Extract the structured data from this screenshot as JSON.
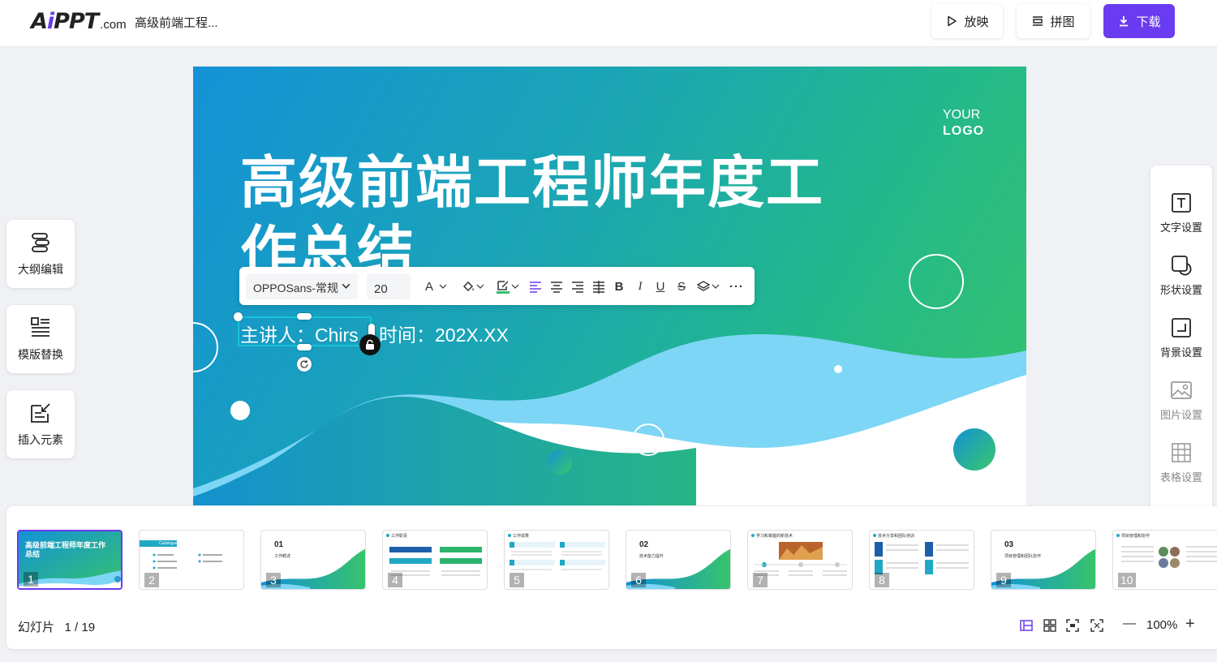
{
  "header": {
    "logo_brand_a": "A",
    "logo_brand_i": "i",
    "logo_brand_rest": "PPT",
    "logo_suffix": ".com",
    "doc_title": "高级前端工程...",
    "play_label": "放映",
    "puzzle_label": "拼图",
    "download_label": "下载",
    "accent_color": "#6a3bf0"
  },
  "left_tools": [
    {
      "label": "大纲编辑",
      "icon": "outline-icon"
    },
    {
      "label": "模版替换",
      "icon": "template-icon"
    },
    {
      "label": "插入元素",
      "icon": "insert-icon"
    }
  ],
  "right_panel": [
    {
      "label": "文字设置",
      "icon": "text-icon",
      "enabled": true
    },
    {
      "label": "形状设置",
      "icon": "shape-icon",
      "enabled": true
    },
    {
      "label": "背景设置",
      "icon": "background-icon",
      "enabled": true
    },
    {
      "label": "图片设置",
      "icon": "image-icon",
      "enabled": false
    },
    {
      "label": "表格设置",
      "icon": "table-icon",
      "enabled": false
    }
  ],
  "slide": {
    "logo_line1": "YOUR",
    "logo_line2": "LOGO",
    "title": "高级前端工程师年度工作总结",
    "speaker": "主讲人：Chirs",
    "time": "时间：202X.XX"
  },
  "text_toolbar": {
    "font": "OPPOSans-常规",
    "size": "20",
    "font_color_glyph": "A",
    "bold_glyph": "B",
    "italic_glyph": "I",
    "underline_glyph": "U",
    "strike_glyph": "S",
    "more_glyph": "···"
  },
  "thumbnails": [
    {
      "n": "1",
      "title": "高级前端工程师年度工作总结",
      "style": "cover"
    },
    {
      "n": "2",
      "title": "Catalogue 目录",
      "style": "catalogue"
    },
    {
      "n": "3",
      "title": "01",
      "sub": "工作概述",
      "style": "section"
    },
    {
      "n": "4",
      "title": "工作职责",
      "style": "content"
    },
    {
      "n": "5",
      "title": "工作成果",
      "style": "content"
    },
    {
      "n": "6",
      "title": "02",
      "sub": "技术能力提升",
      "style": "section"
    },
    {
      "n": "7",
      "title": "学习和掌握的新技术",
      "style": "photo"
    },
    {
      "n": "8",
      "title": "技术分享和团队培训",
      "style": "content"
    },
    {
      "n": "9",
      "title": "03",
      "sub": "项目管理和团队协作",
      "style": "section"
    },
    {
      "n": "10",
      "title": "项目管理和协作",
      "style": "content"
    }
  ],
  "footer": {
    "slide_label": "幻灯片",
    "slide_position": "1 / 19",
    "zoom": "100%",
    "minus_glyph": "—",
    "plus_glyph": "+"
  }
}
